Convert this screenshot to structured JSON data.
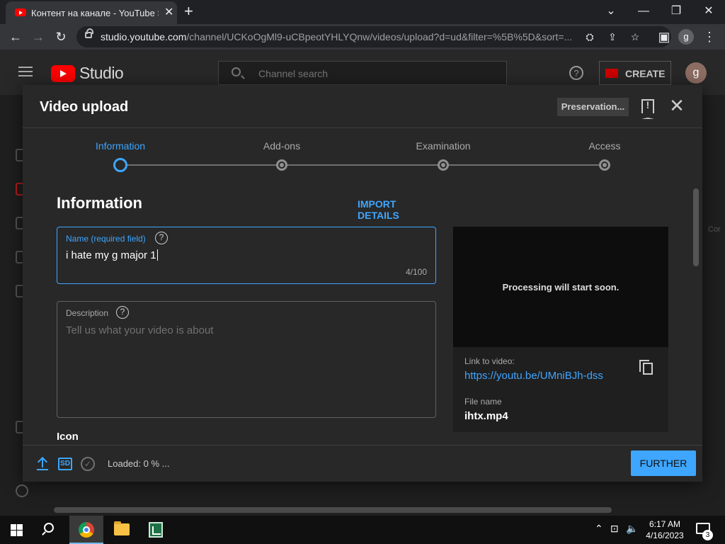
{
  "browser": {
    "tab_title": "Контент на канале - YouTube Studio",
    "url_host": "studio.youtube.com",
    "url_path": "/channel/UCKoOgMl9-uCBpeotYHLYQnw/videos/upload?d=ud&filter=%5B%5D&sort=...",
    "profile_initial": "g"
  },
  "studio": {
    "logo_text": "Studio",
    "search_placeholder": "Channel search",
    "create_label": "CREATE",
    "avatar_initial": "g"
  },
  "modal": {
    "title": "Video upload",
    "preservation_label": "Preservation...",
    "steps": [
      {
        "label": "Information",
        "active": true
      },
      {
        "label": "Add-ons",
        "active": false
      },
      {
        "label": "Examination",
        "active": false
      },
      {
        "label": "Access",
        "active": false
      }
    ],
    "section_title": "Information",
    "import_label": "IMPORT DETAILS",
    "name_field": {
      "label": "Name (required field)",
      "value": "i hate my g major 1",
      "counter": "4/100"
    },
    "description_field": {
      "label": "Description",
      "placeholder": "Tell us what your video is about"
    },
    "next_heading": "Icon",
    "preview": {
      "processing_text": "Processing will start soon.",
      "link_label": "Link to video:",
      "link_url": "https://youtu.be/UMniBJh-dss",
      "file_label": "File name",
      "file_name": "ihtx.mp4"
    },
    "footer": {
      "sd_label": "SD",
      "loaded_text": "Loaded: 0 % ...",
      "further_label": "FURTHER"
    }
  },
  "right_cut_text": "Cor",
  "taskbar": {
    "time": "6:17 AM",
    "date": "4/16/2023",
    "notification_count": "3"
  },
  "colors": {
    "accent": "#3ea6ff",
    "brand_red": "#ff0000",
    "modal_bg": "#282828"
  }
}
